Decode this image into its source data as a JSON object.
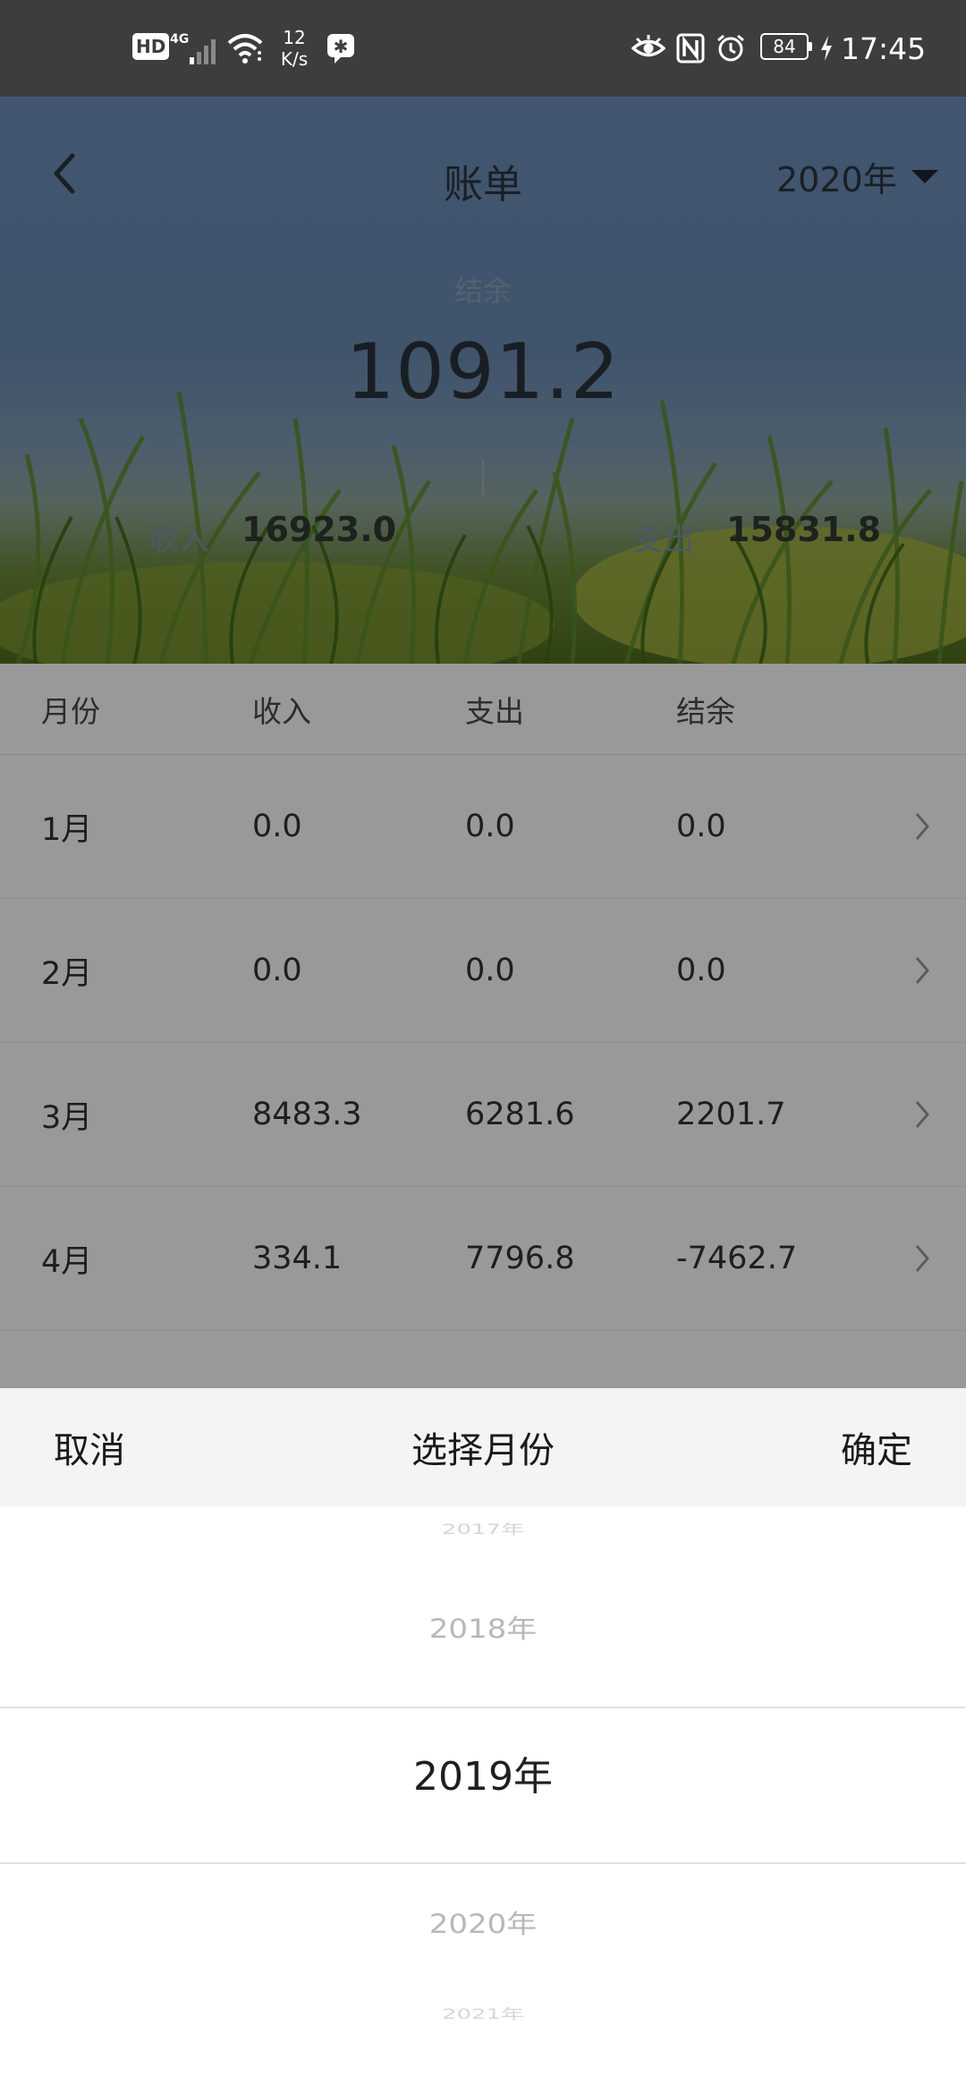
{
  "status_bar": {
    "hd": "HD",
    "network": "4G",
    "speed_value": "12",
    "speed_unit": "K/s",
    "battery": "84",
    "time": "17:45"
  },
  "header": {
    "title": "账单",
    "year": "2020年"
  },
  "summary": {
    "balance_label": "结余",
    "balance_value": "1091.2",
    "income_label": "收入",
    "income_value": "16923.0",
    "expense_label": "支出",
    "expense_value": "15831.8"
  },
  "table": {
    "columns": [
      "月份",
      "收入",
      "支出",
      "结余"
    ],
    "rows": [
      {
        "month": "1月",
        "income": "0.0",
        "expense": "0.0",
        "balance": "0.0"
      },
      {
        "month": "2月",
        "income": "0.0",
        "expense": "0.0",
        "balance": "0.0"
      },
      {
        "month": "3月",
        "income": "8483.3",
        "expense": "6281.6",
        "balance": "2201.7"
      },
      {
        "month": "4月",
        "income": "334.1",
        "expense": "7796.8",
        "balance": "-7462.7"
      }
    ]
  },
  "picker": {
    "cancel_label": "取消",
    "title": "选择月份",
    "confirm_label": "确定",
    "items": [
      "2017年",
      "2018年",
      "2019年",
      "2020年",
      "2021年"
    ],
    "selected": "2019年"
  }
}
